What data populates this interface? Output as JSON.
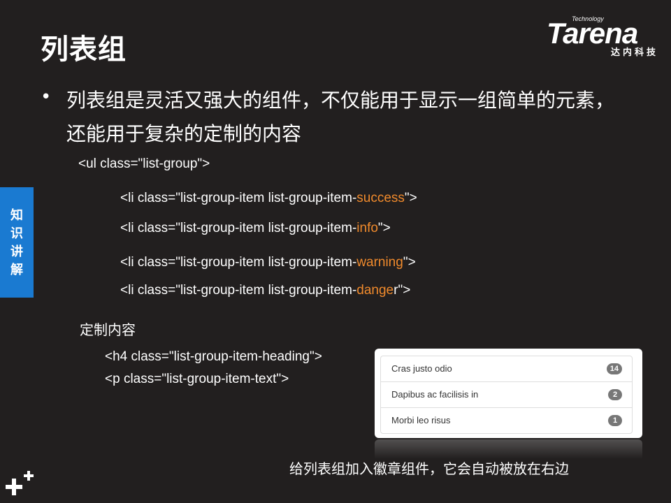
{
  "slide": {
    "title": "列表组",
    "bullet": "列表组是灵活又强大的组件，不仅能用于显示一组简单的元素，还能用于复杂的定制的内容",
    "side_tab": "知识讲解",
    "section_label": "定制内容",
    "caption": "给列表组加入徽章组件，它会自动被放在右边"
  },
  "logo": {
    "tagline": "Technology",
    "word": "Tarena",
    "cn": "达内科技"
  },
  "code": {
    "ul_line": "<ul class=\"list-group\">",
    "items": [
      {
        "prefix": "<li class=\"list-group-item list-group-item-",
        "highlight": "success",
        "suffix": "\">"
      },
      {
        "prefix": "<li class=\"list-group-item list-group-item-",
        "highlight": "info",
        "suffix": "\">"
      },
      {
        "prefix": "<li class=\"list-group-item list-group-item-",
        "highlight": "warning",
        "suffix": "\">"
      },
      {
        "prefix": "<li class=\"list-group-item list-group-item-",
        "highlight": "dange",
        "suffix": "r\">"
      }
    ],
    "h4_line": "<h4 class=\"list-group-item-heading\">",
    "p_line": "<p class=\"list-group-item-text\">"
  },
  "demo": {
    "items": [
      {
        "text": "Cras justo odio",
        "badge": "14"
      },
      {
        "text": "Dapibus ac facilisis in",
        "badge": "2"
      },
      {
        "text": "Morbi leo risus",
        "badge": "1"
      }
    ]
  },
  "colors": {
    "background": "#221f1f",
    "highlight": "#f08a2c",
    "side_tab": "#1a7ad1"
  },
  "icons": {
    "plus": "plus-icon"
  }
}
